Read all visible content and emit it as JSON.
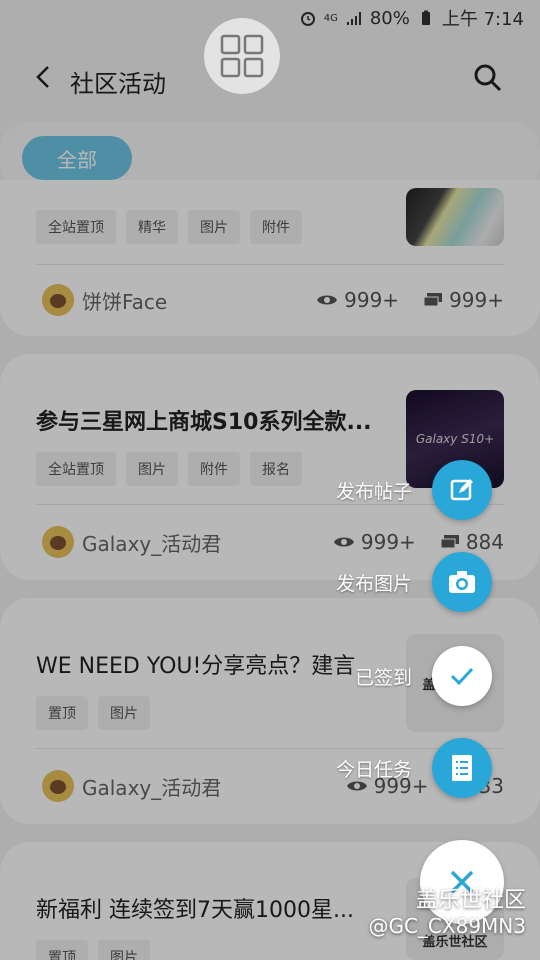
{
  "status_bar": {
    "signal_label": "4G",
    "battery": "80%",
    "time": "上午 7:14"
  },
  "header": {
    "title": "社区活动"
  },
  "filter": {
    "chip_label": "全部"
  },
  "posts": [
    {
      "title": "",
      "tags": [
        "全站置顶",
        "精华",
        "图片",
        "附件"
      ],
      "author": "饼饼Face",
      "views": "999+",
      "replies": "999+"
    },
    {
      "title": "参与三星网上商城S10系列全款...",
      "tags": [
        "全站置顶",
        "图片",
        "附件",
        "报名"
      ],
      "author": "Galaxy_活动君",
      "views": "999+",
      "replies": "884",
      "thumb_text": "Galaxy S10+"
    },
    {
      "title": "WE NEED YOU!分享亮点？建言",
      "tags": [
        "置顶",
        "图片"
      ],
      "author": "Galaxy_活动君",
      "views": "999+",
      "replies": "33",
      "thumb_text": "盖乐世社区"
    },
    {
      "title": "新福利 连续签到7天赢1000星...",
      "tags": [
        "置顶",
        "图片"
      ],
      "thumb_text": "盖乐世社区"
    }
  ],
  "fab_menu": [
    {
      "label": "发布帖子",
      "icon": "edit-icon"
    },
    {
      "label": "发布图片",
      "icon": "camera-icon"
    },
    {
      "label": "已签到",
      "icon": "check-icon"
    },
    {
      "label": "今日任务",
      "icon": "list-icon"
    }
  ],
  "watermark": {
    "line1": "盖乐世社区",
    "line2": "@GC_CX89MN3"
  },
  "colors": {
    "accent": "#29a7d9",
    "chip": "#6cc6e6"
  }
}
